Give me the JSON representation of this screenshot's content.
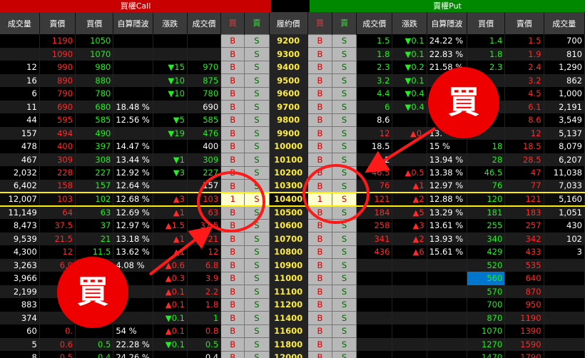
{
  "header": {
    "call_title": "買權Call",
    "put_title": "賣權Put"
  },
  "columns": {
    "call": [
      "成交量",
      "賣價",
      "買價",
      "自算隱波",
      "漲跌",
      "成交價"
    ],
    "buy": "買",
    "sell": "賣",
    "strike": "履約價",
    "put": [
      "成交價",
      "漲跌",
      "自算隱波",
      "買價",
      "賣價",
      "成交量"
    ]
  },
  "button_labels": {
    "buy": "B",
    "sell": "S"
  },
  "annotations": {
    "call_label": "買",
    "put_label": "買"
  },
  "colors": {
    "call_header": "#c80000",
    "put_header": "#008800",
    "up": "#ff2a2a",
    "down": "#22ee22",
    "strike": "#ffee33"
  },
  "rows": [
    {
      "strike": "9200",
      "call": {
        "vol": "",
        "ask": "1190",
        "bid": "1050",
        "iv": "",
        "chg": "",
        "last": ""
      },
      "put": {
        "last": "1.5",
        "chg": "▼0.1",
        "iv": "24.22 %",
        "bid": "1.4",
        "ask": "1.5",
        "vol": "700"
      }
    },
    {
      "strike": "9300",
      "call": {
        "vol": "",
        "ask": "1090",
        "bid": "1070",
        "iv": "",
        "chg": "",
        "last": ""
      },
      "put": {
        "last": "1.8",
        "chg": "▼0.1",
        "iv": "22.83 %",
        "bid": "1.8",
        "ask": "1.9",
        "vol": "810"
      }
    },
    {
      "strike": "9400",
      "call": {
        "vol": "12",
        "ask": "990",
        "bid": "980",
        "iv": "",
        "chg": "▼15",
        "last": "970"
      },
      "put": {
        "last": "2.3",
        "chg": "▼0.2",
        "iv": "21.58 %",
        "bid": "2.3",
        "ask": "2.4",
        "vol": "1,290"
      }
    },
    {
      "strike": "9500",
      "call": {
        "vol": "16",
        "ask": "890",
        "bid": "880",
        "iv": "",
        "chg": "▼10",
        "last": "875"
      },
      "put": {
        "last": "3.2",
        "chg": "▼0.1",
        "iv": "",
        "bid": "",
        "ask": "3.2",
        "vol": "862"
      }
    },
    {
      "strike": "9600",
      "call": {
        "vol": "6",
        "ask": "790",
        "bid": "780",
        "iv": "",
        "chg": "▼10",
        "last": "780"
      },
      "put": {
        "last": "4.4",
        "chg": "▼0.4",
        "iv": "",
        "bid": "",
        "ask": "4.5",
        "vol": "1,000"
      }
    },
    {
      "strike": "9700",
      "call": {
        "vol": "11",
        "ask": "690",
        "bid": "680",
        "iv": "18.48 %",
        "chg": "",
        "last": "690"
      },
      "put": {
        "last": "6",
        "chg": "▼0.4",
        "iv": "",
        "bid": "",
        "ask": "6.1",
        "vol": "2,191"
      }
    },
    {
      "strike": "9800",
      "call": {
        "vol": "44",
        "ask": "595",
        "bid": "585",
        "iv": "12.56 %",
        "chg": "▼5",
        "last": "585"
      },
      "put": {
        "last": "8.6",
        "chg": "",
        "iv": "",
        "bid": "",
        "ask": "8.6",
        "vol": "3,549"
      }
    },
    {
      "strike": "9900",
      "call": {
        "vol": "157",
        "ask": "494",
        "bid": "490",
        "iv": "",
        "chg": "▼19",
        "last": "476"
      },
      "put": {
        "last": "12",
        "chg": "▲0.",
        "iv": "13.",
        "bid": "",
        "ask": "12",
        "vol": "5,137"
      }
    },
    {
      "strike": "10000",
      "call": {
        "vol": "478",
        "ask": "400",
        "bid": "397",
        "iv": "14.47 %",
        "chg": "",
        "last": "400"
      },
      "put": {
        "last": "18.5",
        "chg": "",
        "iv": "15 %",
        "bid": "18",
        "ask": "18.5",
        "vol": "8,079"
      }
    },
    {
      "strike": "10100",
      "call": {
        "vol": "467",
        "ask": "309",
        "bid": "308",
        "iv": "13.44 %",
        "chg": "▼1",
        "last": "309"
      },
      "put": {
        "last": "2",
        "chg": "",
        "iv": "13.94 %",
        "bid": "28",
        "ask": "28.5",
        "vol": "6,207"
      }
    },
    {
      "strike": "10200",
      "call": {
        "vol": "2,032",
        "ask": "228",
        "bid": "227",
        "iv": "12.92 %",
        "chg": "▼3",
        "last": "227"
      },
      "put": {
        "last": "46.5",
        "chg": "▲0.5",
        "iv": "13.38 %",
        "bid": "46.5",
        "ask": "47",
        "vol": "11,038"
      }
    },
    {
      "strike": "10300",
      "call": {
        "vol": "6,402",
        "ask": "158",
        "bid": "157",
        "iv": "12.64 %",
        "chg": "",
        "last": "157"
      },
      "put": {
        "last": "76",
        "chg": "▲1",
        "iv": "12.97 %",
        "bid": "76",
        "ask": "77",
        "vol": "7,033"
      }
    },
    {
      "strike": "10400",
      "call": {
        "vol": "12,007",
        "ask": "103",
        "bid": "102",
        "iv": "12.68 %",
        "chg": "▲3",
        "last": "103"
      },
      "put": {
        "last": "121",
        "chg": "▲2",
        "iv": "12.88 %",
        "bid": "120",
        "ask": "121",
        "vol": "5,160"
      },
      "atm": true,
      "buy_qty": "1",
      "put_buy_qty": "1"
    },
    {
      "strike": "10500",
      "call": {
        "vol": "11,149",
        "ask": "64",
        "bid": "63",
        "iv": "12.69 %",
        "chg": "▲1",
        "last": "63"
      },
      "put": {
        "last": "184",
        "chg": "▲5",
        "iv": "13.29 %",
        "bid": "181",
        "ask": "183",
        "vol": "1,051"
      }
    },
    {
      "strike": "10600",
      "call": {
        "vol": "8,473",
        "ask": "37.5",
        "bid": "37",
        "iv": "12.97 %",
        "chg": "▲1.5",
        "last": "37.5"
      },
      "put": {
        "last": "258",
        "chg": "▲3",
        "iv": "13.61 %",
        "bid": "255",
        "ask": "257",
        "vol": "430"
      }
    },
    {
      "strike": "10700",
      "call": {
        "vol": "9,539",
        "ask": "21.5",
        "bid": "21",
        "iv": "13.18 %",
        "chg": "▲1",
        "last": "21"
      },
      "put": {
        "last": "341",
        "chg": "▲2",
        "iv": "13.93 %",
        "bid": "340",
        "ask": "342",
        "vol": "102"
      }
    },
    {
      "strike": "10800",
      "call": {
        "vol": "4,300",
        "ask": "12",
        "bid": "11.5",
        "iv": "13.62 %",
        "chg": "▲1",
        "last": "12"
      },
      "put": {
        "last": "436",
        "chg": "▲6",
        "iv": "15.61 %",
        "bid": "429",
        "ask": "433",
        "vol": "3"
      }
    },
    {
      "strike": "10900",
      "call": {
        "vol": "3,263",
        "ask": "6.9",
        "bid": "",
        "iv": "4.08 %",
        "chg": "▲0.6",
        "last": "6.8"
      },
      "put": {
        "last": "",
        "chg": "",
        "iv": "",
        "bid": "520",
        "ask": "535",
        "vol": ""
      }
    },
    {
      "strike": "11000",
      "call": {
        "vol": "3,966",
        "ask": "",
        "bid": "",
        "iv": "%",
        "chg": "▲0.3",
        "last": "3.9"
      },
      "put": {
        "last": "",
        "chg": "",
        "iv": "",
        "bid": "560",
        "ask": "640",
        "vol": ""
      },
      "put_bid_highlight": true
    },
    {
      "strike": "11100",
      "call": {
        "vol": "2,199",
        "ask": "",
        "bid": "",
        "iv": "",
        "chg": "▲0.1",
        "last": "2.2"
      },
      "put": {
        "last": "",
        "chg": "",
        "iv": "",
        "bid": "570",
        "ask": "870",
        "vol": ""
      }
    },
    {
      "strike": "11200",
      "call": {
        "vol": "883",
        "ask": "",
        "bid": "",
        "iv": "",
        "chg": "▲0.1",
        "last": "1.8"
      },
      "put": {
        "last": "",
        "chg": "",
        "iv": "",
        "bid": "700",
        "ask": "950",
        "vol": ""
      }
    },
    {
      "strike": "11400",
      "call": {
        "vol": "374",
        "ask": "",
        "bid": "",
        "iv": "",
        "chg": "▼0.1",
        "last": "1"
      },
      "put": {
        "last": "",
        "chg": "",
        "iv": "",
        "bid": "870",
        "ask": "1190",
        "vol": ""
      }
    },
    {
      "strike": "11600",
      "call": {
        "vol": "60",
        "ask": "0.",
        "bid": "",
        "iv": "54 %",
        "chg": "▲0.1",
        "last": "0.8"
      },
      "put": {
        "last": "",
        "chg": "",
        "iv": "",
        "bid": "1070",
        "ask": "1390",
        "vol": ""
      }
    },
    {
      "strike": "11800",
      "call": {
        "vol": "5",
        "ask": "0.6",
        "bid": "0.5",
        "iv": "22.28 %",
        "chg": "▼0.1",
        "last": "0.5"
      },
      "put": {
        "last": "",
        "chg": "",
        "iv": "",
        "bid": "1270",
        "ask": "1590",
        "vol": ""
      }
    },
    {
      "strike": "12000",
      "call": {
        "vol": "8",
        "ask": "0.5",
        "bid": "0.4",
        "iv": "24.26 %",
        "chg": "",
        "last": "0.4"
      },
      "put": {
        "last": "",
        "chg": "",
        "iv": "",
        "bid": "1470",
        "ask": "1790",
        "vol": ""
      }
    }
  ]
}
